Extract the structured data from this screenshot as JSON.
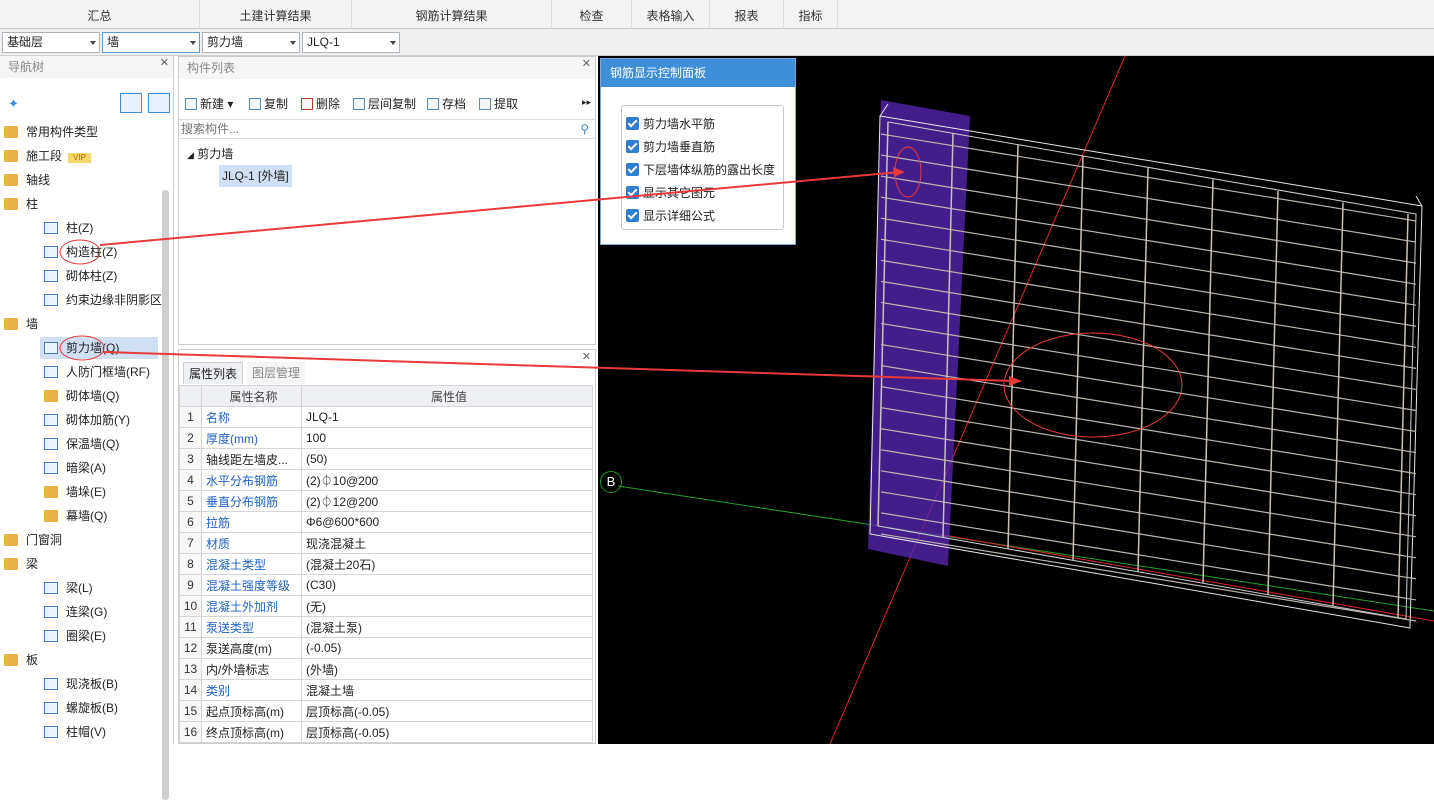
{
  "tabs": [
    {
      "label": "汇总"
    },
    {
      "label": "土建计算结果"
    },
    {
      "label": "钢筋计算结果"
    },
    {
      "label": ""
    },
    {
      "label": "检查"
    },
    {
      "label": "表格输入"
    },
    {
      "label": "报表"
    },
    {
      "label": "指标"
    }
  ],
  "selectors": {
    "floor": "基础层",
    "category": "墙",
    "type": "剪力墙",
    "component": "JLQ-1"
  },
  "nav": {
    "title": "导航树",
    "groups": [
      {
        "label": "常用构件类型"
      },
      {
        "label": "施工段",
        "badge": "VIP"
      },
      {
        "label": "轴线"
      },
      {
        "label": "柱"
      },
      {
        "label": "柱(Z)"
      },
      {
        "label": "构造柱(Z)"
      },
      {
        "label": "砌体柱(Z)"
      },
      {
        "label": "约束边缘非阴影区"
      },
      {
        "label": "墙"
      },
      {
        "label": "剪力墙(Q)"
      },
      {
        "label": "人防门框墙(RF)"
      },
      {
        "label": "砌体墙(Q)"
      },
      {
        "label": "砌体加筋(Y)"
      },
      {
        "label": "保温墙(Q)"
      },
      {
        "label": "暗梁(A)"
      },
      {
        "label": "墙垛(E)"
      },
      {
        "label": "幕墙(Q)"
      },
      {
        "label": "门窗洞"
      },
      {
        "label": "梁"
      },
      {
        "label": "梁(L)"
      },
      {
        "label": "连梁(G)"
      },
      {
        "label": "圈梁(E)"
      },
      {
        "label": "板"
      },
      {
        "label": "现浇板(B)"
      },
      {
        "label": "螺旋板(B)"
      },
      {
        "label": "柱帽(V)"
      }
    ]
  },
  "component_list": {
    "title": "构件列表",
    "toolbar": {
      "new": "新建",
      "copy": "复制",
      "delete": "删除",
      "floor_copy": "层间复制",
      "save": "存档",
      "extract": "提取"
    },
    "search_placeholder": "搜索构件...",
    "tree_parent": "剪力墙",
    "tree_child": "JLQ-1 [外墙]"
  },
  "properties": {
    "tab1": "属性列表",
    "tab2": "图层管理",
    "col_name": "属性名称",
    "col_value": "属性值",
    "rows": [
      {
        "no": "1",
        "name": "名称",
        "value": "JLQ-1"
      },
      {
        "no": "2",
        "name": "厚度(mm)",
        "value": "100"
      },
      {
        "no": "3",
        "name": "轴线距左墙皮...",
        "value": "(50)"
      },
      {
        "no": "4",
        "name": "水平分布钢筋",
        "value": "(2)⏀10@200"
      },
      {
        "no": "5",
        "name": "垂直分布钢筋",
        "value": "(2)⏀12@200"
      },
      {
        "no": "6",
        "name": "拉筋",
        "value": "Φ6@600*600"
      },
      {
        "no": "7",
        "name": "材质",
        "value": "现浇混凝土"
      },
      {
        "no": "8",
        "name": "混凝土类型",
        "value": "(混凝土20石)"
      },
      {
        "no": "9",
        "name": "混凝土强度等级",
        "value": "(C30)"
      },
      {
        "no": "10",
        "name": "混凝土外加剂",
        "value": "(无)"
      },
      {
        "no": "11",
        "name": "泵送类型",
        "value": "(混凝土泵)"
      },
      {
        "no": "12",
        "name": "泵送高度(m)",
        "value": "(-0.05)"
      },
      {
        "no": "13",
        "name": "内/外墙标志",
        "value": "(外墙)"
      },
      {
        "no": "14",
        "name": "类别",
        "value": "混凝土墙"
      },
      {
        "no": "15",
        "name": "起点顶标高(m)",
        "value": "层顶标高(-0.05)"
      },
      {
        "no": "16",
        "name": "终点顶标高(m)",
        "value": "层顶标高(-0.05)"
      }
    ]
  },
  "control_panel": {
    "title": "钢筋显示控制面板",
    "options": [
      {
        "label": "剪力墙水平筋",
        "checked": true
      },
      {
        "label": "剪力墙垂直筋",
        "checked": true
      },
      {
        "label": "下层墙体纵筋的露出长度",
        "checked": true
      },
      {
        "label": "显示其它图元",
        "checked": true
      },
      {
        "label": "显示详细公式",
        "checked": true
      }
    ]
  },
  "axis_label": "B",
  "colors": {
    "accent": "#3f8ed8",
    "annotation": "#e83a3a",
    "wall_highlight": "#6a2fc4"
  }
}
